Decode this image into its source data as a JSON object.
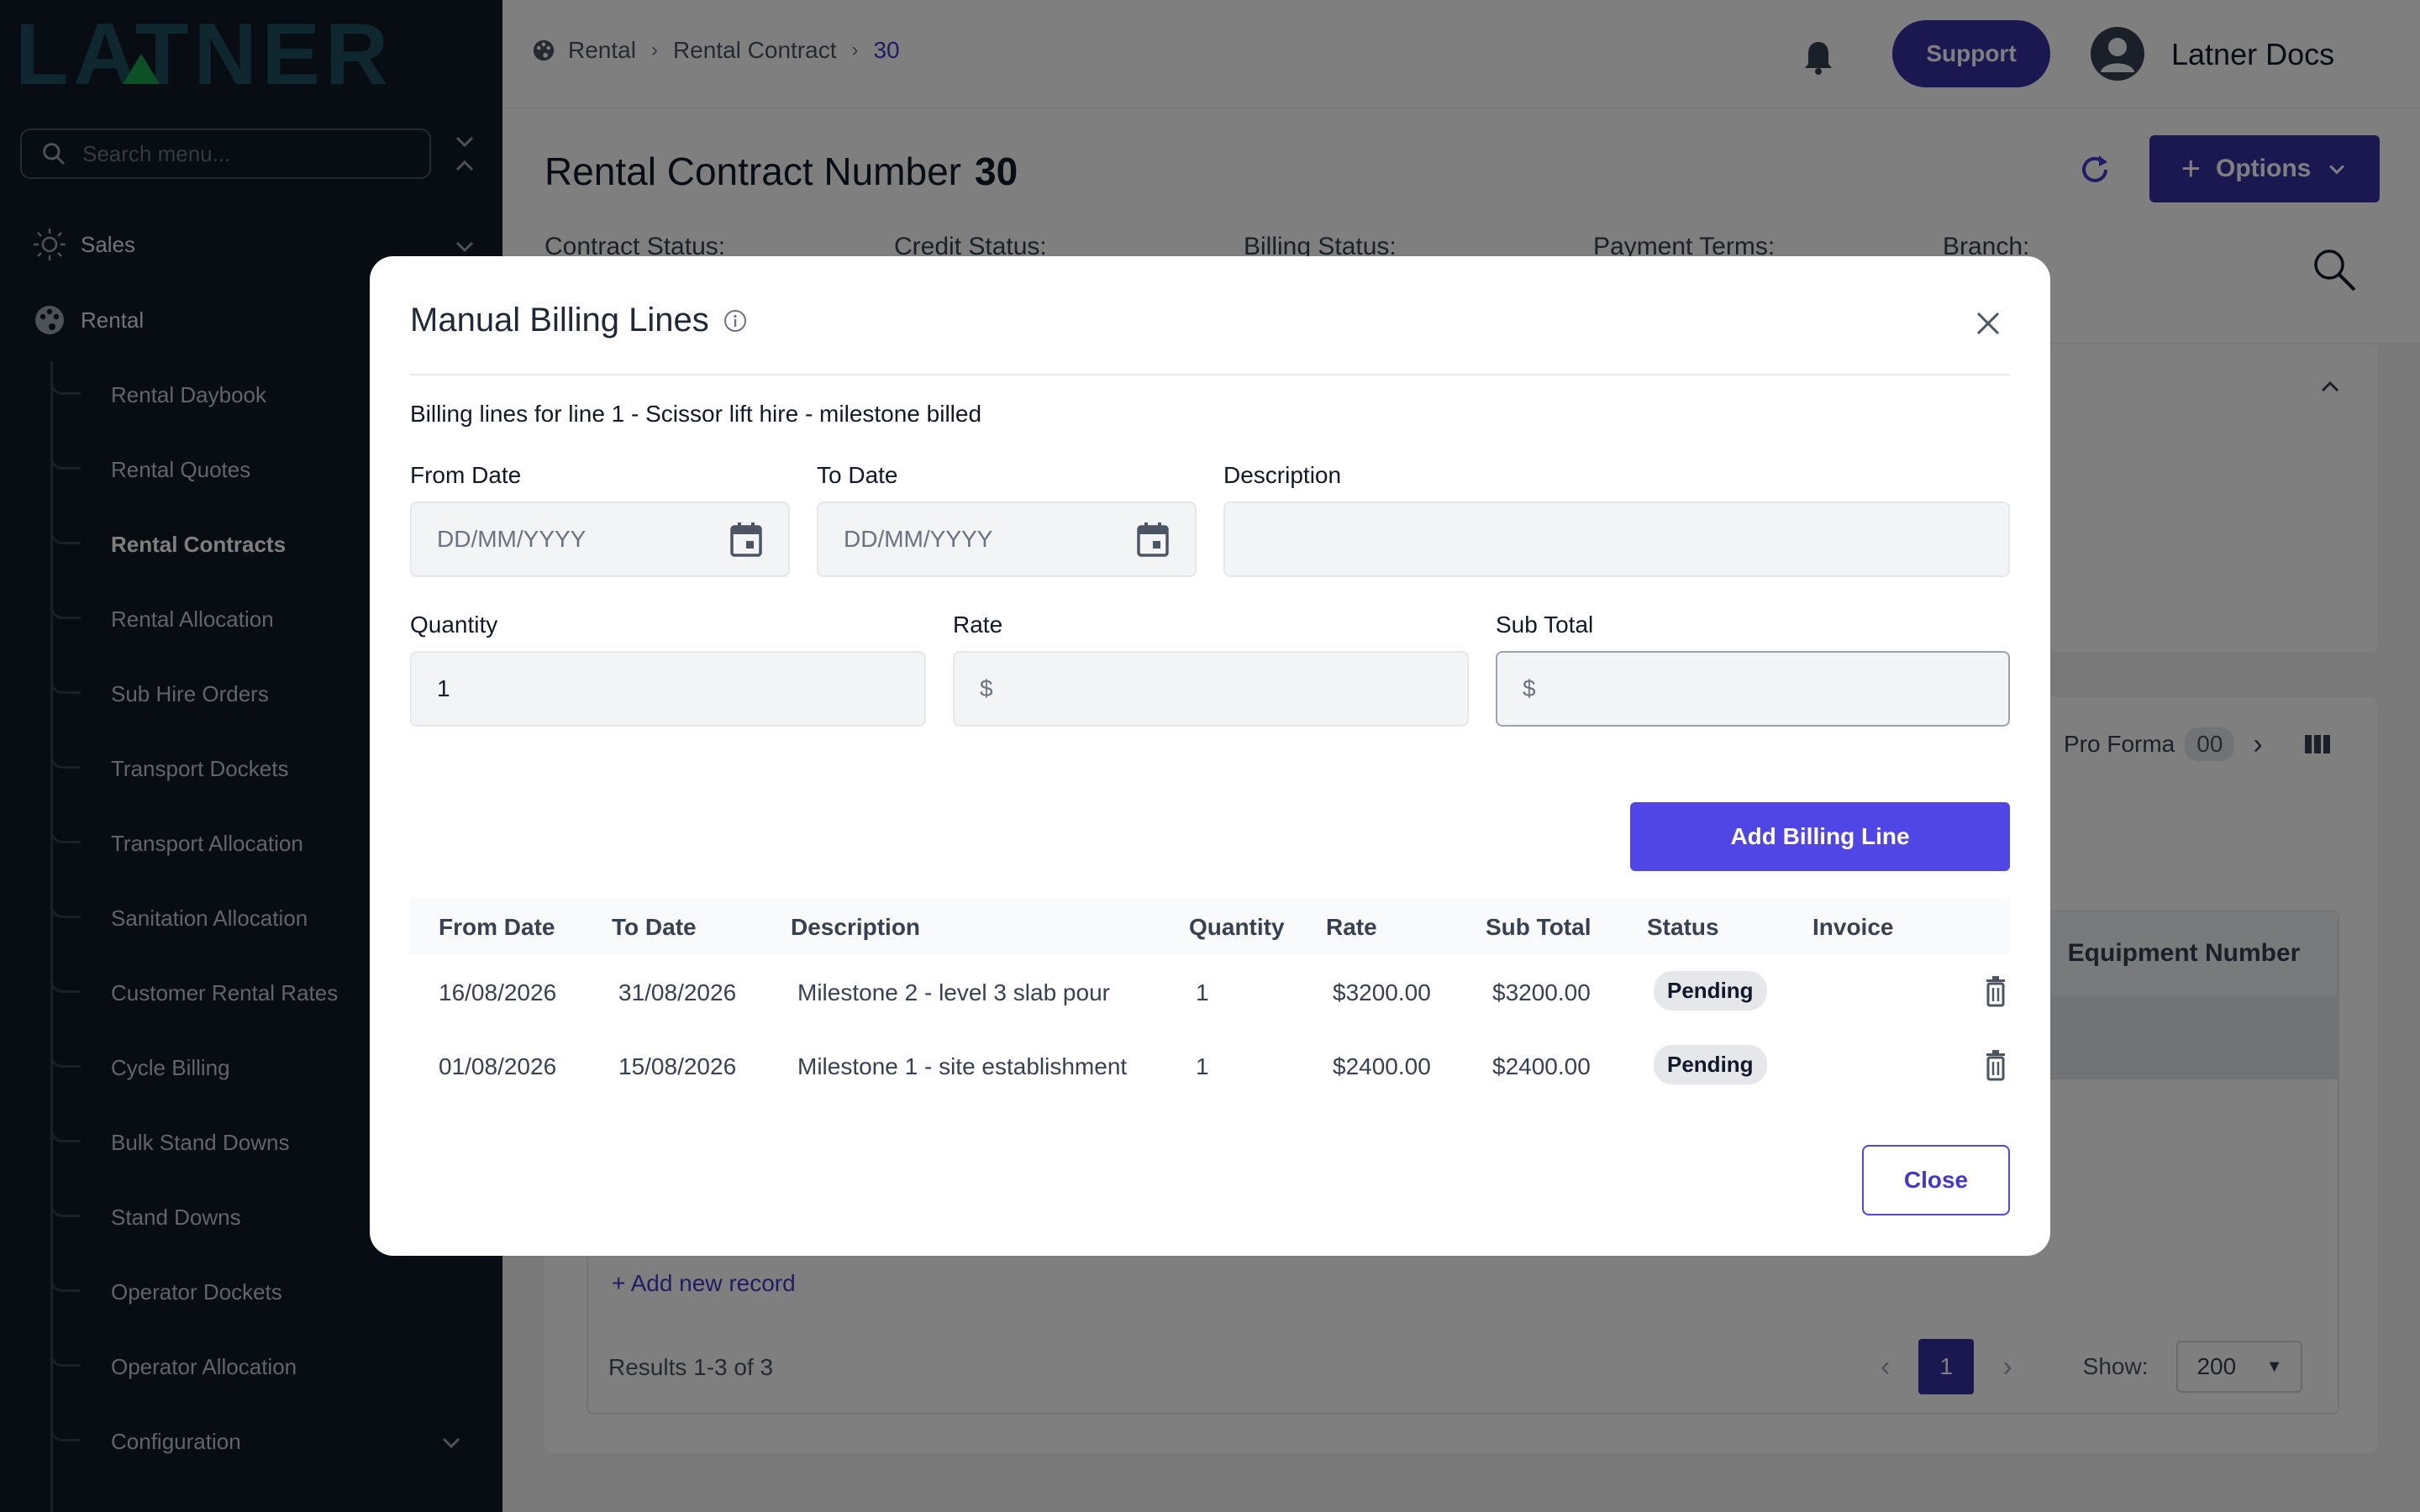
{
  "app": {
    "logo_text": "LATNER",
    "search_placeholder": "Search menu..."
  },
  "sidebar": {
    "top_items": [
      {
        "label": "Sales",
        "icon": "sun-icon"
      },
      {
        "label": "Rental",
        "icon": "palette-icon"
      }
    ],
    "sub_items": [
      {
        "label": "Rental Daybook"
      },
      {
        "label": "Rental Quotes"
      },
      {
        "label": "Rental Contracts",
        "active": true
      },
      {
        "label": "Rental Allocation"
      },
      {
        "label": "Sub Hire Orders"
      },
      {
        "label": "Transport Dockets"
      },
      {
        "label": "Transport Allocation"
      },
      {
        "label": "Sanitation Allocation"
      },
      {
        "label": "Customer Rental Rates"
      },
      {
        "label": "Cycle Billing"
      },
      {
        "label": "Bulk Stand Downs"
      },
      {
        "label": "Stand Downs"
      },
      {
        "label": "Operator Dockets"
      },
      {
        "label": "Operator Allocation"
      },
      {
        "label": "Configuration"
      }
    ]
  },
  "topbar": {
    "breadcrumb": [
      "Rental",
      "Rental Contract",
      "30"
    ],
    "support_label": "Support",
    "user_name": "Latner Docs"
  },
  "page": {
    "title": "Rental Contract Number",
    "number": "30",
    "options_label": "Options",
    "status_labels": [
      "Contract Status:",
      "Credit Status:",
      "Billing Status:",
      "Payment Terms:",
      "Branch:"
    ],
    "proforma_label": "Pro Forma",
    "proforma_count": "00",
    "equipment_header": "Equipment Number",
    "add_record": "+ Add new record",
    "results": "Results 1-3 of 3",
    "current_page": "1",
    "show_label": "Show:",
    "show_value": "200"
  },
  "modal": {
    "title": "Manual Billing Lines",
    "subtitle": "Billing lines for line 1 - Scissor lift hire - milestone billed",
    "from_date_label": "From Date",
    "to_date_label": "To Date",
    "description_label": "Description",
    "date_placeholder": "DD/MM/YYYY",
    "quantity_label": "Quantity",
    "quantity_value": "1",
    "rate_label": "Rate",
    "subtotal_label": "Sub Total",
    "currency_symbol": "$",
    "add_button": "Add Billing Line",
    "close_button": "Close",
    "columns": [
      "From Date",
      "To Date",
      "Description",
      "Quantity",
      "Rate",
      "Sub Total",
      "Status",
      "Invoice"
    ],
    "rows": [
      {
        "from": "16/08/2026",
        "to": "31/08/2026",
        "description": "Milestone 2 - level 3 slab pour",
        "quantity": "1",
        "rate": "$3200.00",
        "subtotal": "$3200.00",
        "status": "Pending",
        "invoice": ""
      },
      {
        "from": "01/08/2026",
        "to": "15/08/2026",
        "description": "Milestone 1 - site establishment",
        "quantity": "1",
        "rate": "$2400.00",
        "subtotal": "$2400.00",
        "status": "Pending",
        "invoice": ""
      }
    ]
  },
  "colors": {
    "sidebar_bg": "#111827",
    "primary": "#3730a3",
    "accent_button": "#4f46e5",
    "logo_teal": "#1f4e5c",
    "logo_green": "#22c55e"
  }
}
